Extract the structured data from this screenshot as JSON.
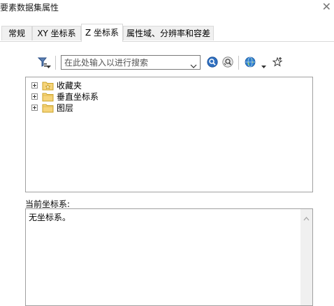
{
  "window": {
    "title": "要素数据集属性"
  },
  "tabs": [
    {
      "label": "常规",
      "active": false
    },
    {
      "label": "XY 坐标系",
      "active": false
    },
    {
      "label": "Z 坐标系",
      "active": true
    },
    {
      "label": "属性域、分辨率和容差",
      "active": false
    }
  ],
  "toolbar": {
    "search_placeholder": "在此处输入以进行搜索",
    "search_value": ""
  },
  "tree": {
    "items": [
      {
        "label": "收藏夹",
        "icon": "favorites-folder-icon"
      },
      {
        "label": "垂直坐标系",
        "icon": "folder-icon"
      },
      {
        "label": "图层",
        "icon": "folder-icon"
      }
    ]
  },
  "current": {
    "label": "当前坐标系:",
    "value": "无坐标系。"
  },
  "colors": {
    "folder_fill": "#f6d47a",
    "folder_stroke": "#c9a227",
    "search_blue": "#2e6fc0",
    "globe_blue": "#2f7fd0",
    "tab_border": "#d9d9d9"
  }
}
